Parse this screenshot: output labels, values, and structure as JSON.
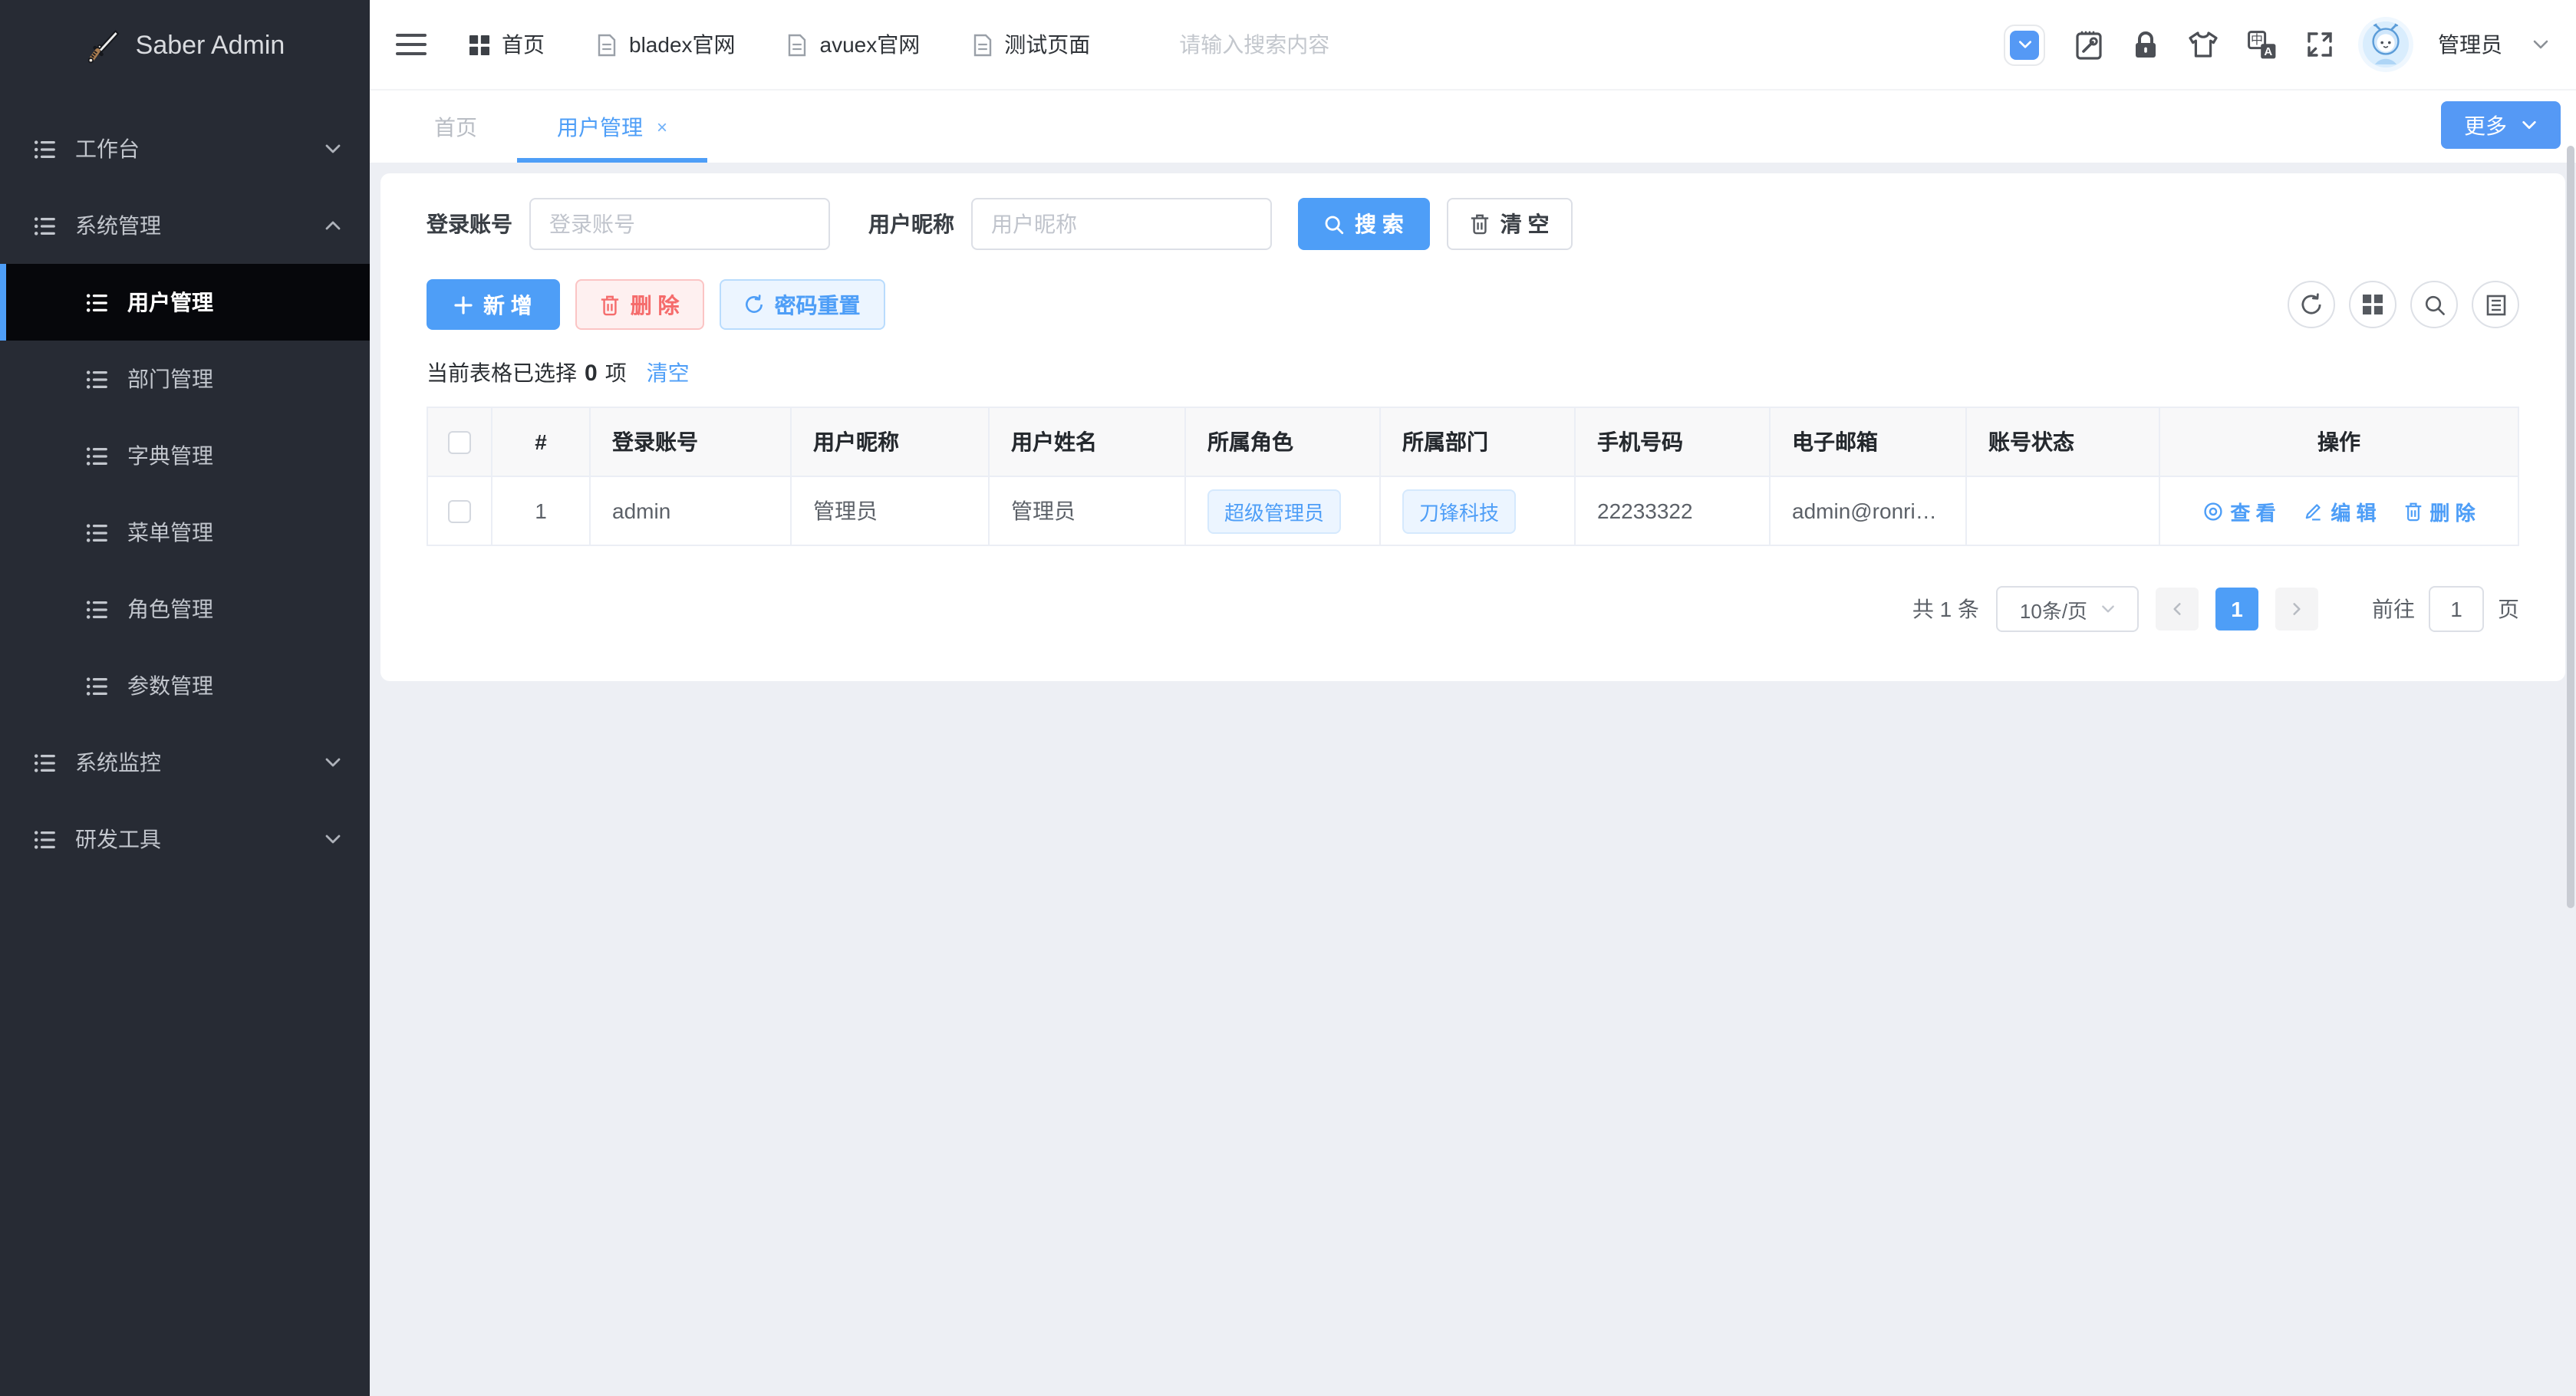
{
  "app": {
    "title": "Saber Admin"
  },
  "colors": {
    "primary": "#4e9ef7",
    "danger": "#f56c6c",
    "sidebar_bg": "#272b34",
    "active_bg": "#06070b",
    "tag_bg": "#ecf5ff"
  },
  "sidebar": {
    "sections": [
      {
        "label": "工作台"
      },
      {
        "label": "系统管理",
        "children": [
          "用户管理",
          "部门管理",
          "字典管理",
          "菜单管理",
          "角色管理",
          "参数管理"
        ]
      },
      {
        "label": "系统监控"
      },
      {
        "label": "研发工具"
      }
    ]
  },
  "topbar": {
    "menu": [
      "首页",
      "bladex官网",
      "avuex官网",
      "测试页面"
    ],
    "search_placeholder": "请输入搜索内容",
    "user_name": "管理员"
  },
  "tabs": {
    "home": "首页",
    "active": "用户管理",
    "close": "×",
    "more": "更多"
  },
  "filters": {
    "account_label": "登录账号",
    "account_placeholder": "登录账号",
    "nickname_label": "用户昵称",
    "nickname_placeholder": "用户昵称",
    "search": "搜 索",
    "clear": "清 空"
  },
  "toolbar": {
    "add": "新 增",
    "remove": "删 除",
    "reset": "密码重置"
  },
  "selection": {
    "text_before": "当前表格已选择",
    "count": "0",
    "text_after": "项",
    "clear": "清空"
  },
  "table": {
    "headers": [
      "#",
      "登录账号",
      "用户昵称",
      "用户姓名",
      "所属角色",
      "所属部门",
      "手机号码",
      "电子邮箱",
      "账号状态",
      "操作"
    ],
    "row": {
      "index": "1",
      "account": "admin",
      "nickname": "管理员",
      "realname": "管理员",
      "role": "超级管理员",
      "dept": "刀锋科技",
      "phone": "22233322",
      "email": "admin@ronris...",
      "status": "",
      "view": "查 看",
      "edit": "编 辑",
      "del": "删 除"
    }
  },
  "pagination": {
    "total": "共 1 条",
    "size": "10条/页",
    "page": "1",
    "goto": "前往",
    "goto_value": "1",
    "unit": "页"
  }
}
